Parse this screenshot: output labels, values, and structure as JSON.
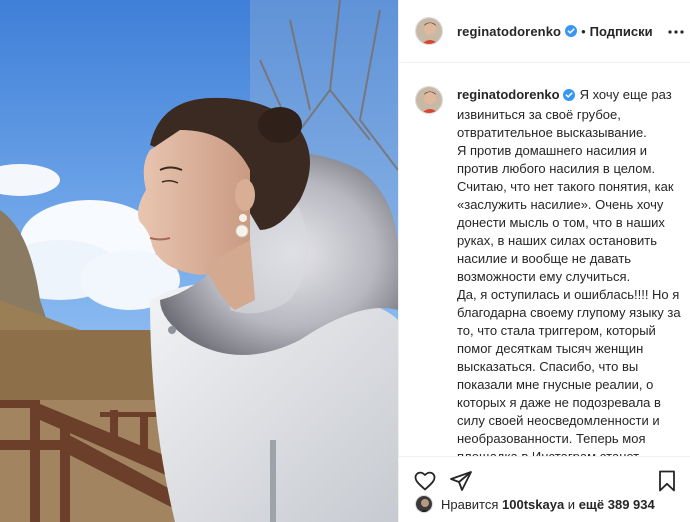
{
  "author": {
    "username": "reginatodorenko",
    "verified": true,
    "follow_label": "Подписки",
    "separator": "•"
  },
  "caption": {
    "text": "Я хочу еще раз\nизвиниться за своё грубое,\nотвратительное высказывание.\nЯ против домашнего насилия и\nпротив любого насилия в целом.\nСчитаю, что нет такого понятия, как\n«заслужить насилие». Очень хочу\nдонести мысль о том, что в наших\nруках, в наших силах остановить\nнасилие и вообще не давать\nвозможности ему случиться.\nДа, я оступилась и ошиблась!!!! Но я\nблагодарна своему глупому языку за\nто, что стала триггером, который\nпомог десяткам тысяч женщин\nвысказаться. Спасибо, что вы\nпоказали мне гнусные реалии, о\nкоторых я даже не подозревала в\nсилу своей неосведомленности и\nнеобразованности. Теперь моя\nплощадка в Инстаграм станет\nдомом для тех, кто готов говорить о\nдомашнем насилии и больше не"
  },
  "likes": {
    "prefix": "Нравится",
    "user": "100tskaya",
    "connector": "и",
    "others": "ещё 389 934"
  },
  "icons": {
    "like": "heart-icon",
    "share": "paper-plane-icon",
    "save": "bookmark-icon",
    "more": "more-options-icon",
    "verified": "verified-badge-icon"
  },
  "colors": {
    "verified": "#3897f0",
    "border": "#efefef",
    "text": "#262626"
  }
}
